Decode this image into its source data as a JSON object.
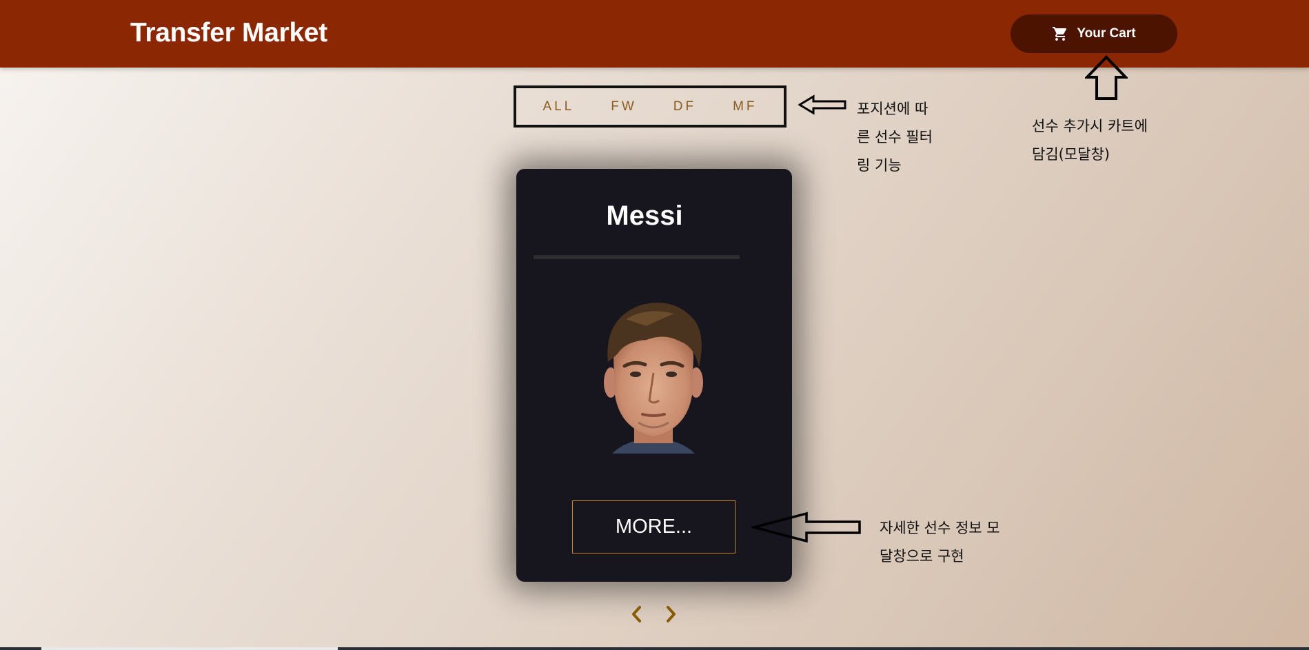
{
  "header": {
    "brand": "Transfer Market",
    "cart_label": "Your Cart",
    "cart_icon": "shopping-cart-icon"
  },
  "filters": [
    {
      "label": "ALL"
    },
    {
      "label": "FW"
    },
    {
      "label": "DF"
    },
    {
      "label": "MF"
    }
  ],
  "card": {
    "player_name": "Messi",
    "more_label": "MORE..."
  },
  "annotations": {
    "filter_note_lines": [
      "포지션에 따",
      "른 선수 필터",
      "링 기능"
    ],
    "cart_note_lines": [
      "선수 추가시 카트에",
      "담김(모달창)"
    ],
    "more_note_lines": [
      "자세한 선수 정보 모",
      "달창으로 구현"
    ]
  },
  "colors": {
    "header": "#8b2702",
    "cart_button": "#4c1300",
    "card": "#17151e",
    "filter_text": "#8a5a20",
    "more_border": "#c8892e",
    "nav_arrows": "#8a5a00"
  }
}
